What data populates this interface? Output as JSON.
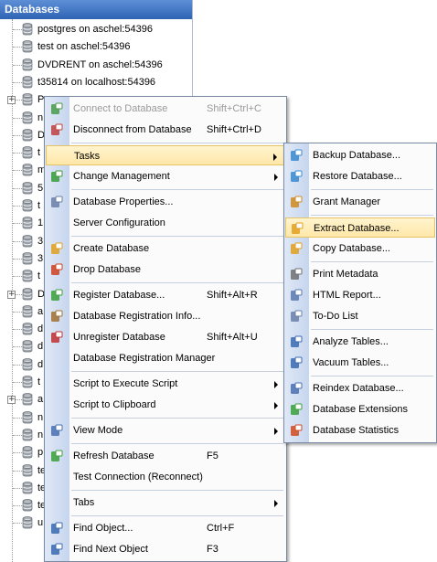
{
  "panel": {
    "title": "Databases",
    "tree_items": [
      {
        "label": "postgres on aschel:54396"
      },
      {
        "label": "test on aschel:54396"
      },
      {
        "label": "DVDRENT on aschel:54396"
      },
      {
        "label": "t35814 on localhost:54396"
      },
      {
        "label": "P",
        "expander": "+"
      },
      {
        "label": "n"
      },
      {
        "label": "D"
      },
      {
        "label": "t"
      },
      {
        "label": "m"
      },
      {
        "label": "5"
      },
      {
        "label": "t"
      },
      {
        "label": "1"
      },
      {
        "label": "3"
      },
      {
        "label": "3"
      },
      {
        "label": "t"
      },
      {
        "label": "D",
        "expander": "+"
      },
      {
        "label": "a"
      },
      {
        "label": "d"
      },
      {
        "label": "d"
      },
      {
        "label": "d"
      },
      {
        "label": "t"
      },
      {
        "label": "a",
        "expander": "+"
      },
      {
        "label": "n"
      },
      {
        "label": "n"
      },
      {
        "label": "p"
      },
      {
        "label": "te"
      },
      {
        "label": "te"
      },
      {
        "label": "te"
      },
      {
        "label": "u"
      }
    ]
  },
  "context_menu": {
    "items": [
      {
        "id": "connect",
        "label": "Connect to Database",
        "shortcut": "Shift+Ctrl+C",
        "disabled": true,
        "icon": "connect-icon",
        "color": "#4a9a4a"
      },
      {
        "id": "disconnect",
        "label": "Disconnect from Database",
        "shortcut": "Shift+Ctrl+D",
        "icon": "disconnect-icon",
        "color": "#c04040"
      },
      {
        "sep": true
      },
      {
        "id": "tasks",
        "label": "Tasks",
        "submenu": true,
        "highlighted": true
      },
      {
        "id": "change-management",
        "label": "Change Management",
        "submenu": true,
        "icon": "change-management-icon",
        "color": "#3a9a3a"
      },
      {
        "sep": true
      },
      {
        "id": "db-properties",
        "label": "Database Properties...",
        "icon": "properties-icon",
        "color": "#6a7fa8"
      },
      {
        "id": "server-config",
        "label": "Server Configuration"
      },
      {
        "sep": true
      },
      {
        "id": "create-db",
        "label": "Create Database",
        "icon": "create-database-icon",
        "color": "#e0a020"
      },
      {
        "id": "drop-db",
        "label": "Drop Database",
        "icon": "drop-database-icon",
        "color": "#d04020"
      },
      {
        "sep": true
      },
      {
        "id": "register-db",
        "label": "Register Database...",
        "shortcut": "Shift+Alt+R",
        "icon": "register-database-icon",
        "color": "#3aa03a"
      },
      {
        "id": "reg-info",
        "label": "Database Registration Info...",
        "icon": "registration-info-icon",
        "color": "#a07030"
      },
      {
        "id": "unregister-db",
        "label": "Unregister Database",
        "shortcut": "Shift+Alt+U",
        "icon": "unregister-database-icon",
        "color": "#c03030"
      },
      {
        "id": "reg-manager",
        "label": "Database Registration Manager"
      },
      {
        "sep": true
      },
      {
        "id": "script-exec",
        "label": "Script to Execute Script",
        "submenu": true
      },
      {
        "id": "script-clip",
        "label": "Script to Clipboard",
        "submenu": true
      },
      {
        "sep": true
      },
      {
        "id": "view-mode",
        "label": "View Mode",
        "submenu": true,
        "icon": "view-mode-icon",
        "color": "#4a70b0"
      },
      {
        "sep": true
      },
      {
        "id": "refresh",
        "label": "Refresh Database",
        "shortcut": "F5",
        "icon": "refresh-icon",
        "color": "#3aa03a"
      },
      {
        "id": "test-conn",
        "label": "Test Connection (Reconnect)"
      },
      {
        "sep": true
      },
      {
        "id": "tabs",
        "label": "Tabs",
        "submenu": true
      },
      {
        "sep": true
      },
      {
        "id": "find",
        "label": "Find Object...",
        "shortcut": "Ctrl+F",
        "icon": "find-icon",
        "color": "#3a6ab0"
      },
      {
        "id": "find-next",
        "label": "Find Next Object",
        "shortcut": "F3",
        "icon": "find-next-icon",
        "color": "#3a6ab0"
      }
    ]
  },
  "tasks_submenu": {
    "items": [
      {
        "id": "backup",
        "label": "Backup Database...",
        "icon": "backup-icon",
        "color": "#3a8ad0"
      },
      {
        "id": "restore",
        "label": "Restore Database...",
        "icon": "restore-icon",
        "color": "#3a8ad0"
      },
      {
        "sep": true
      },
      {
        "id": "grant",
        "label": "Grant Manager",
        "icon": "grant-manager-icon",
        "color": "#d08a20"
      },
      {
        "sep": true
      },
      {
        "id": "extract",
        "label": "Extract Database...",
        "icon": "extract-icon",
        "color": "#e0a020",
        "highlighted": true
      },
      {
        "id": "copy",
        "label": "Copy Database...",
        "icon": "copy-database-icon",
        "color": "#e0a020"
      },
      {
        "sep": true
      },
      {
        "id": "print-meta",
        "label": "Print Metadata",
        "icon": "print-icon",
        "color": "#707070"
      },
      {
        "id": "html-report",
        "label": "HTML Report...",
        "icon": "html-report-icon",
        "color": "#5a7ab0"
      },
      {
        "id": "todo",
        "label": "To-Do List",
        "icon": "todo-list-icon",
        "color": "#6a80a8"
      },
      {
        "sep": true
      },
      {
        "id": "analyze",
        "label": "Analyze Tables...",
        "icon": "analyze-tables-icon",
        "color": "#3a6ab0"
      },
      {
        "id": "vacuum",
        "label": "Vacuum Tables...",
        "icon": "vacuum-tables-icon",
        "color": "#3a6ab0"
      },
      {
        "sep": true
      },
      {
        "id": "reindex",
        "label": "Reindex Database...",
        "icon": "reindex-icon",
        "color": "#4a70b0"
      },
      {
        "id": "extensions",
        "label": "Database Extensions",
        "icon": "extensions-icon",
        "color": "#3aa03a"
      },
      {
        "id": "stats",
        "label": "Database Statistics",
        "icon": "statistics-icon",
        "color": "#d04a20"
      }
    ]
  }
}
